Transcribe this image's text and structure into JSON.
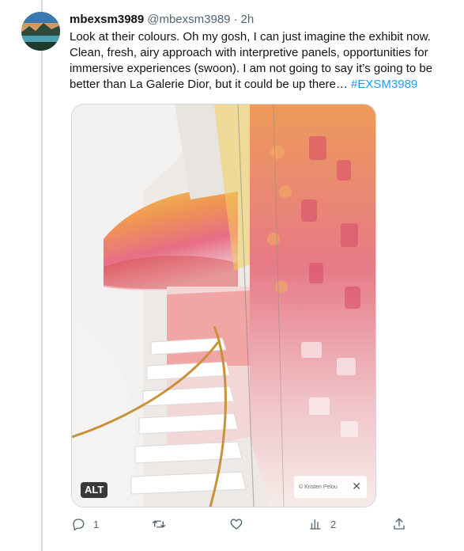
{
  "tweet": {
    "display_name": "mbexsm3989",
    "handle": "@mbexsm3989",
    "separator": "·",
    "time": "2h",
    "text_main": "Look at their colours. Oh my gosh, I can just imagine the exhibit now. Clean, fresh, airy approach with interpretive panels, opportunities for immersive experiences (swoon). I am not going to say it’s going to be better than La Galerie Dior, but it could be up there… ",
    "hashtag": "#EXSM3989"
  },
  "media": {
    "alt_label": "ALT",
    "credit": "© Kristen Pelou",
    "close_glyph": "✕",
    "description_icon": "photo"
  },
  "actions": {
    "reply_count": "1",
    "retweet_count": "",
    "like_count": "",
    "views_count": "2"
  },
  "colors": {
    "text": "#0f1419",
    "secondary": "#536471",
    "link": "#1d9bf0",
    "border": "#cfd9de"
  }
}
